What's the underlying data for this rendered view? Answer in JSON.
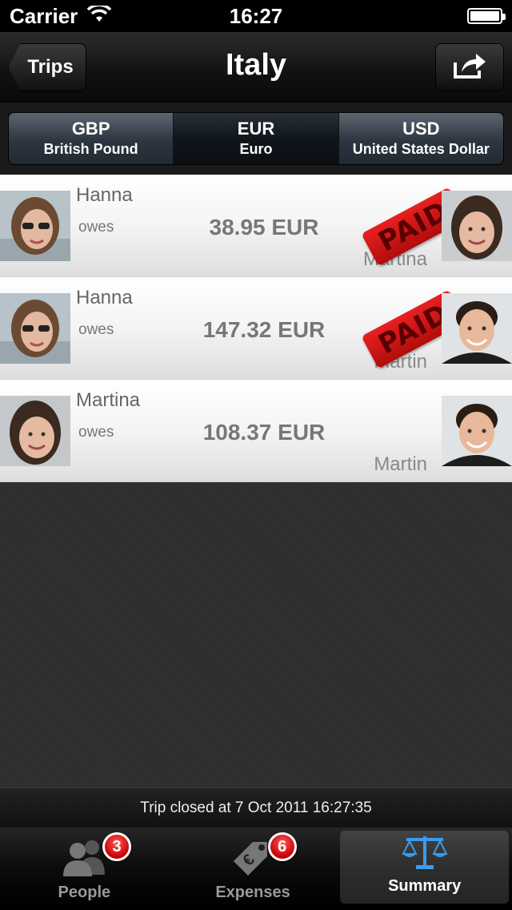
{
  "status_bar": {
    "carrier": "Carrier",
    "time": "16:27"
  },
  "nav": {
    "back_label": "Trips",
    "title": "Italy"
  },
  "currencies": [
    {
      "code": "GBP",
      "name": "British Pound",
      "selected": false
    },
    {
      "code": "EUR",
      "name": "Euro",
      "selected": true
    },
    {
      "code": "USD",
      "name": "United States Dollar",
      "selected": false
    }
  ],
  "debts": [
    {
      "debtor": "Hanna",
      "verb": "owes",
      "amount": "38.95 EUR",
      "creditor": "Martina",
      "stamp": "PAID"
    },
    {
      "debtor": "Hanna",
      "verb": "owes",
      "amount": "147.32 EUR",
      "creditor": "Martin",
      "stamp": "PAID"
    },
    {
      "debtor": "Martina",
      "verb": "owes",
      "amount": "108.37 EUR",
      "creditor": "Martin",
      "stamp": ""
    }
  ],
  "footer": {
    "status": "Trip closed at 7 Oct 2011 16:27:35"
  },
  "tabs": [
    {
      "label": "People",
      "badge": "3",
      "icon": "people-icon"
    },
    {
      "label": "Expenses",
      "badge": "6",
      "icon": "euro-tag-icon"
    },
    {
      "label": "Summary",
      "badge": "",
      "icon": "scales-icon"
    }
  ],
  "colors": {
    "accent": "#3d9be9",
    "stamp": "#d41414",
    "badge": "#d40000"
  }
}
